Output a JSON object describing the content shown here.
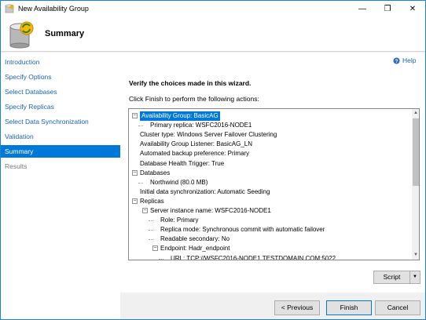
{
  "window": {
    "title": "New Availability Group",
    "controls": [
      "—",
      "❐",
      "✕"
    ]
  },
  "header": {
    "title": "Summary"
  },
  "nav": {
    "items": [
      {
        "label": "Introduction",
        "state": "link"
      },
      {
        "label": "Specify Options",
        "state": "link"
      },
      {
        "label": "Select Databases",
        "state": "link"
      },
      {
        "label": "Specify Replicas",
        "state": "link"
      },
      {
        "label": "Select Data Synchronization",
        "state": "link"
      },
      {
        "label": "Validation",
        "state": "link"
      },
      {
        "label": "Summary",
        "state": "active"
      },
      {
        "label": "Results",
        "state": "disabled"
      }
    ]
  },
  "content": {
    "help_label": "Help",
    "heading": "Verify the choices made in this wizard.",
    "instruction": "Click Finish to perform the following actions:",
    "tree": [
      {
        "text": "Availability Group: BasicAG",
        "level": 0,
        "expander": "−",
        "selected": true
      },
      {
        "text": "Primary replica: WSFC2016-NODE1",
        "level": 1
      },
      {
        "text": "Cluster type: Windows Server Failover Clustering",
        "level": 0
      },
      {
        "text": "Availability Group Listener: BasicAG_LN",
        "level": 0
      },
      {
        "text": "Automated backup preference: Primary",
        "level": 0
      },
      {
        "text": "Database Health Trigger: True",
        "level": 0
      },
      {
        "text": "Databases",
        "level": 0,
        "expander": "−"
      },
      {
        "text": "Northwind (80.0 MB)",
        "level": 1
      },
      {
        "text": "Initial data synchronization: Automatic Seeding",
        "level": 0
      },
      {
        "text": "Replicas",
        "level": 0,
        "expander": "−"
      },
      {
        "text": "Server instance name: WSFC2016-NODE1",
        "level": 1,
        "expander": "−"
      },
      {
        "text": "Role: Primary",
        "level": 2
      },
      {
        "text": "Replica mode: Synchronous commit with automatic failover",
        "level": 2
      },
      {
        "text": "Readable secondary: No",
        "level": 2
      },
      {
        "text": "Endpoint: Hadr_endpoint",
        "level": 2,
        "expander": "−"
      },
      {
        "text": "URL: TCP://WSFC2016-NODE1.TESTDOMAIN.COM:5022",
        "level": 3
      }
    ],
    "script_label": "Script"
  },
  "buttons": {
    "previous": "< Previous",
    "finish": "Finish",
    "cancel": "Cancel"
  }
}
